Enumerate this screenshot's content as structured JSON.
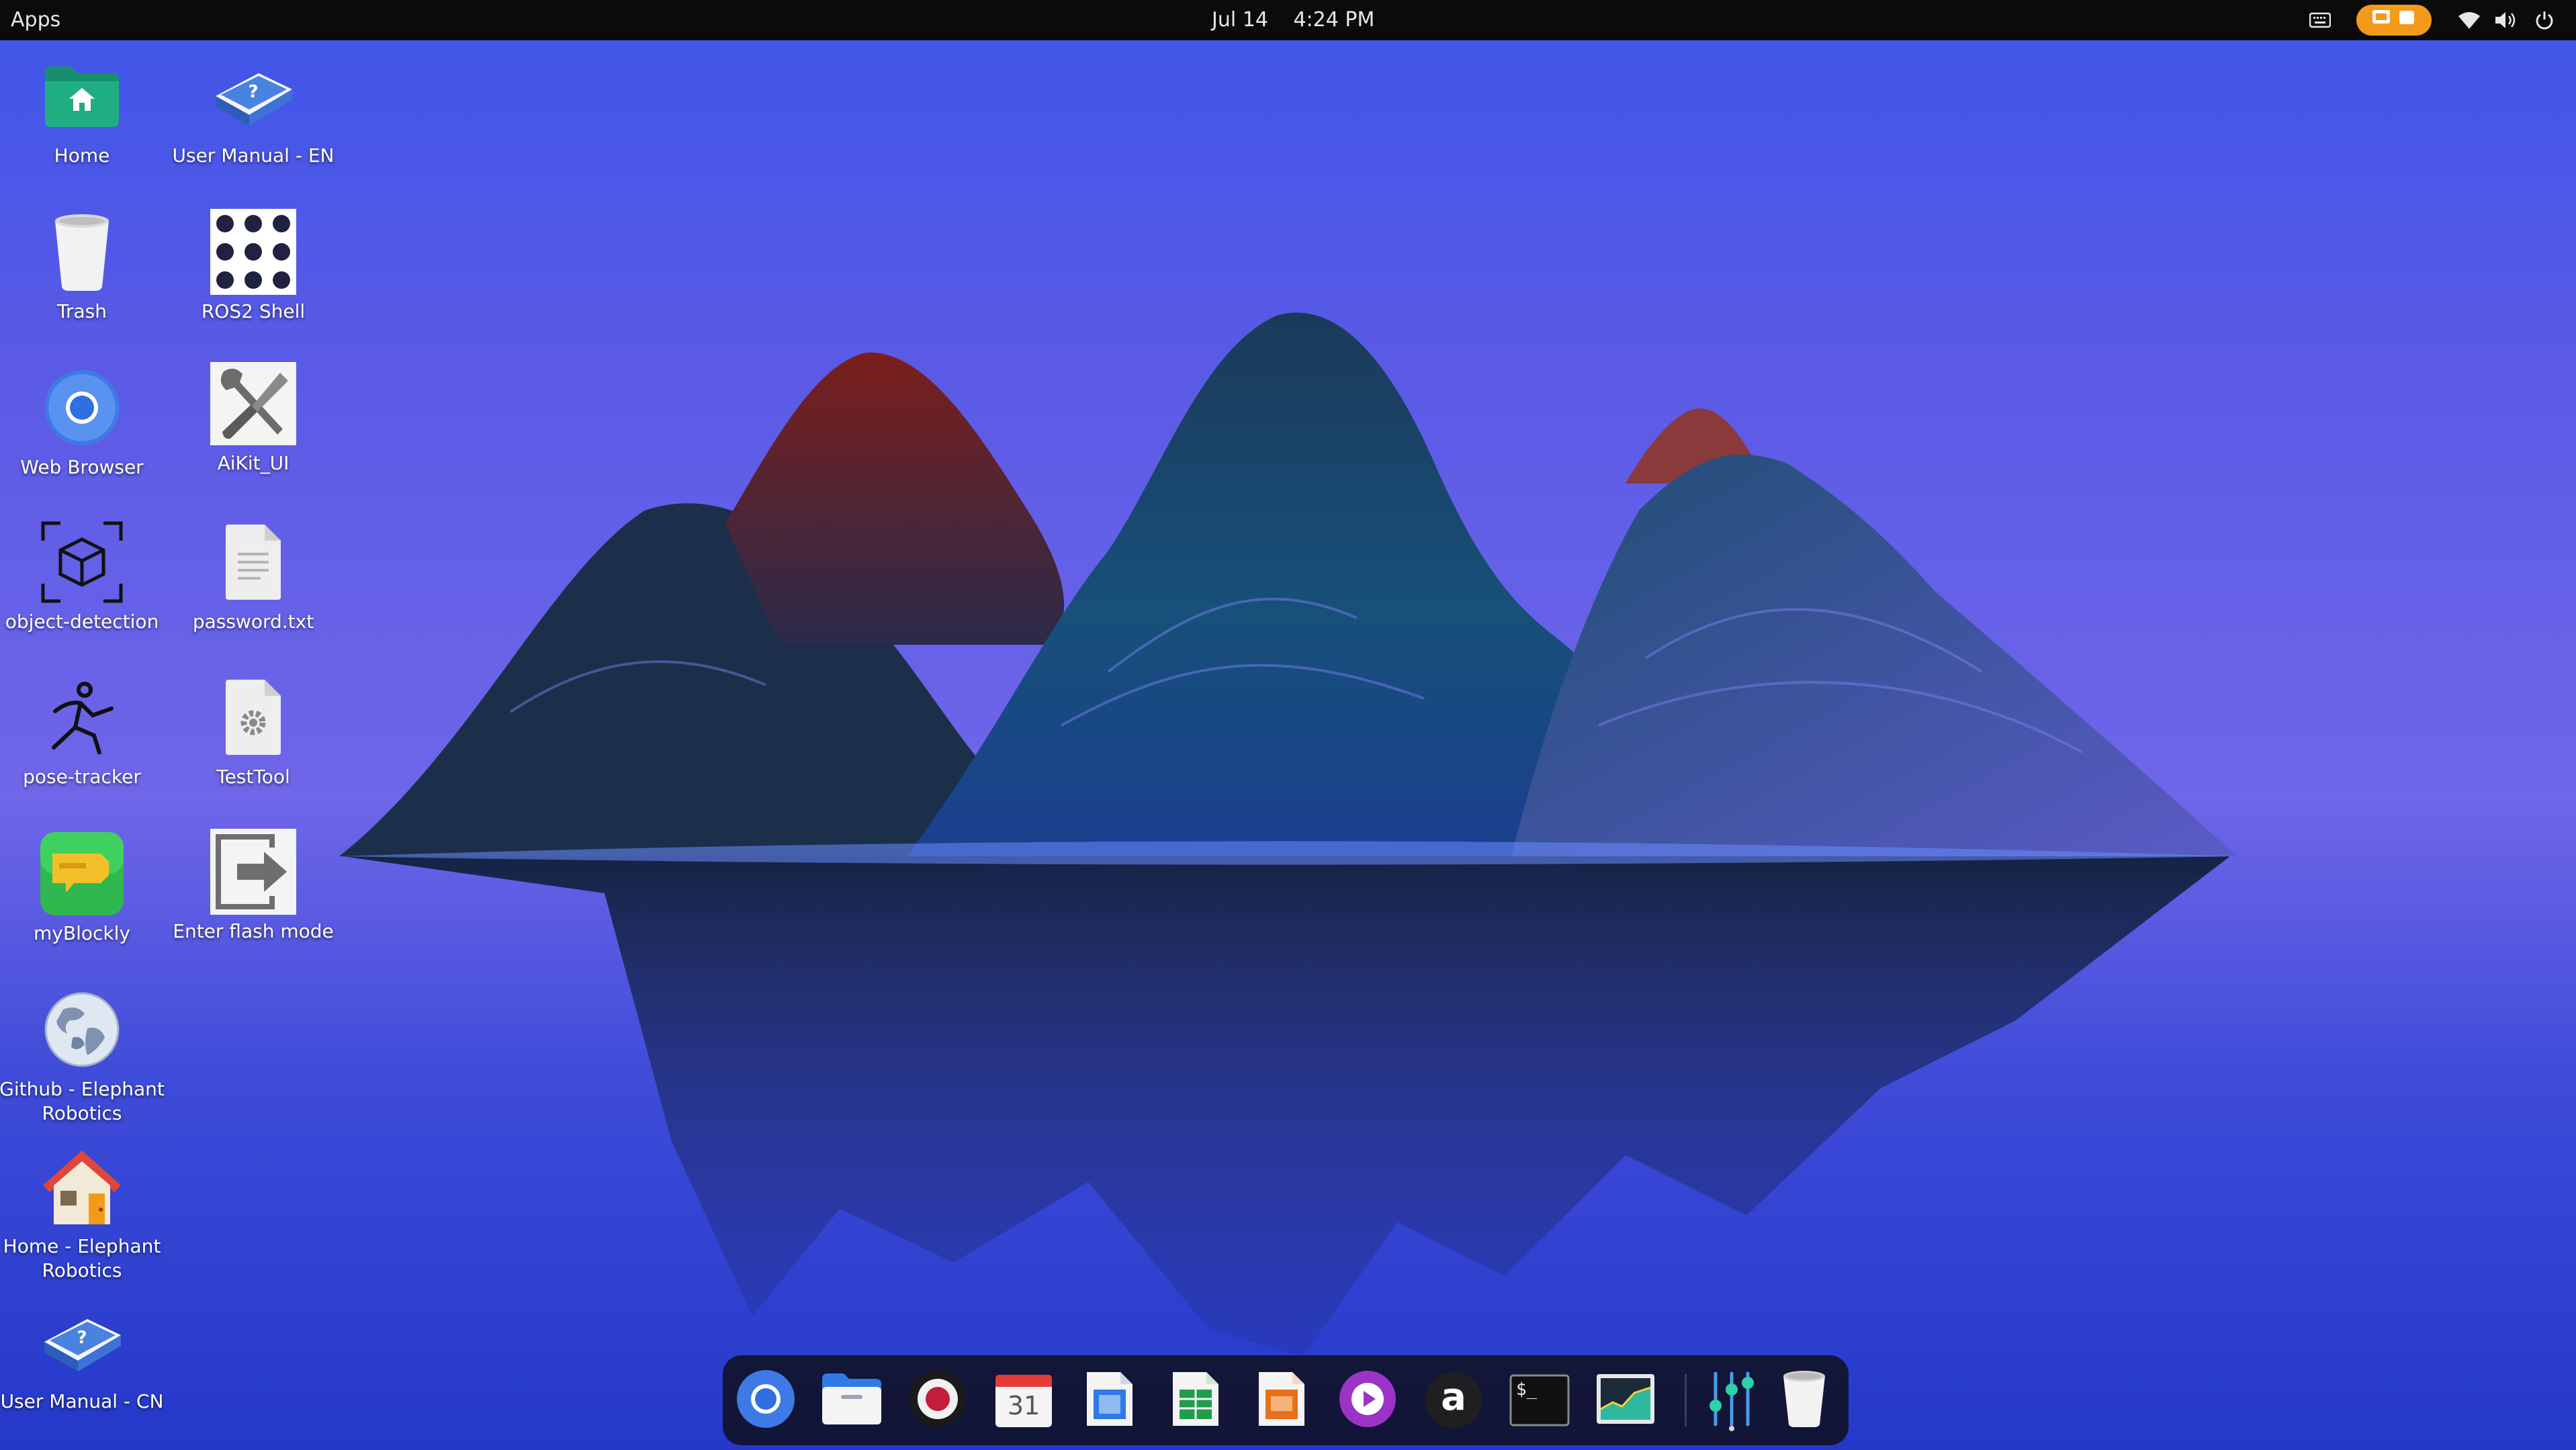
{
  "topbar": {
    "apps_label": "Apps",
    "date": "Jul 14",
    "time": "4:24 PM",
    "tray_icons": [
      "keyboard-icon",
      "screen-share-icon",
      "wifi-icon",
      "volume-icon",
      "power-icon"
    ]
  },
  "desktop": {
    "icons": [
      {
        "label": "Home",
        "icon": "home-folder-icon"
      },
      {
        "label": "User Manual - EN",
        "icon": "help-book-icon"
      },
      {
        "label": "Trash",
        "icon": "trash-icon"
      },
      {
        "label": "ROS2 Shell",
        "icon": "dot-grid-icon"
      },
      {
        "label": "Web Browser",
        "icon": "chromium-icon"
      },
      {
        "label": "AiKit_UI",
        "icon": "tools-icon"
      },
      {
        "label": "object-detection",
        "icon": "cube-scan-icon"
      },
      {
        "label": "password.txt",
        "icon": "text-file-icon"
      },
      {
        "label": "pose-tracker",
        "icon": "running-figure-icon"
      },
      {
        "label": "TestTool",
        "icon": "settings-file-icon"
      },
      {
        "label": "myBlockly",
        "icon": "blockly-icon"
      },
      {
        "label": "Enter flash mode",
        "icon": "flash-arrow-icon"
      },
      {
        "label": "Github - Elephant Robotics",
        "icon": "globe-icon"
      },
      {
        "label": "Home - Elephant Robotics",
        "icon": "house-icon"
      },
      {
        "label": "User Manual - CN",
        "icon": "help-book-icon"
      }
    ]
  },
  "dock": {
    "calendar_day": "31",
    "terminal_prompt": "$_",
    "store_letter": "a",
    "apps": [
      "chromium-icon",
      "files-icon",
      "screen-recorder-icon",
      "calendar-icon",
      "writer-icon",
      "calc-icon",
      "impress-icon",
      "video-player-icon",
      "app-store-icon",
      "terminal-icon",
      "system-monitor-icon",
      "equalizer-icon",
      "trash-icon"
    ]
  },
  "colors": {
    "topbar": "#0b0b0c",
    "accent_orange": "#f39a1a",
    "sky_top": "#4a4ee6",
    "water": "#2f43d4"
  }
}
